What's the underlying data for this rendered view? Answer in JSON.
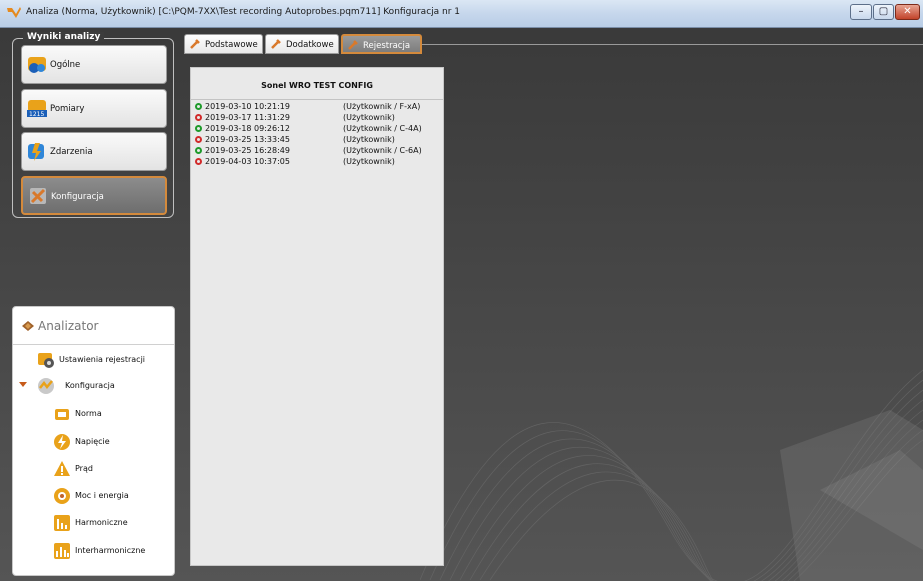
{
  "window": {
    "title": "Analiza (Norma, Użytkownik) [C:\\PQM-7XX\\Test recording Autoprobes.pqm711] Konfiguracja nr 1",
    "min_glyph": "–",
    "max_glyph": "▢",
    "close_glyph": "✕"
  },
  "results": {
    "legend": "Wyniki analizy",
    "buttons": [
      {
        "label": "Ogólne",
        "icon": "general-icon"
      },
      {
        "label": "Pomiary",
        "icon": "measurements-icon"
      },
      {
        "label": "Zdarzenia",
        "icon": "events-icon"
      },
      {
        "label": "Konfiguracja",
        "icon": "configuration-icon",
        "active": true
      }
    ]
  },
  "analyzer": {
    "title": "Analizator",
    "items": [
      {
        "label": "Ustawienia rejestracji",
        "icon": "recording-settings-icon"
      },
      {
        "label": "Konfiguracja",
        "icon": "configuration-icon",
        "expanded": true
      },
      {
        "label": "Norma",
        "icon": "norm-icon"
      },
      {
        "label": "Napięcie",
        "icon": "voltage-icon"
      },
      {
        "label": "Prąd",
        "icon": "current-icon"
      },
      {
        "label": "Moc i energia",
        "icon": "power-energy-icon"
      },
      {
        "label": "Harmoniczne",
        "icon": "harmonics-icon"
      },
      {
        "label": "Interharmoniczne",
        "icon": "interharmonics-icon"
      }
    ]
  },
  "tabs": [
    {
      "label": "Podstawowe",
      "active": false
    },
    {
      "label": "Dodatkowe",
      "active": false
    },
    {
      "label": "Rejestracja",
      "active": true
    }
  ],
  "panel": {
    "title": "Sonel WRO TEST CONFIG",
    "entries": [
      {
        "status": "green",
        "date": "2019-03-10 10:21:19",
        "user": "(Użytkownik / F-xA)"
      },
      {
        "status": "red",
        "date": "2019-03-17 11:31:29",
        "user": "(Użytkownik)"
      },
      {
        "status": "green",
        "date": "2019-03-18 09:26:12",
        "user": "(Użytkownik / C-4A)"
      },
      {
        "status": "red",
        "date": "2019-03-25 13:33:45",
        "user": "(Użytkownik)"
      },
      {
        "status": "green",
        "date": "2019-03-25 16:28:49",
        "user": "(Użytkownik / C-6A)"
      },
      {
        "status": "red",
        "date": "2019-04-03 10:37:05",
        "user": "(Użytkownik)"
      }
    ]
  },
  "colors": {
    "accent": "#d48a3c",
    "status_ok": "#1e9a2a",
    "status_error": "#d12a2a"
  }
}
